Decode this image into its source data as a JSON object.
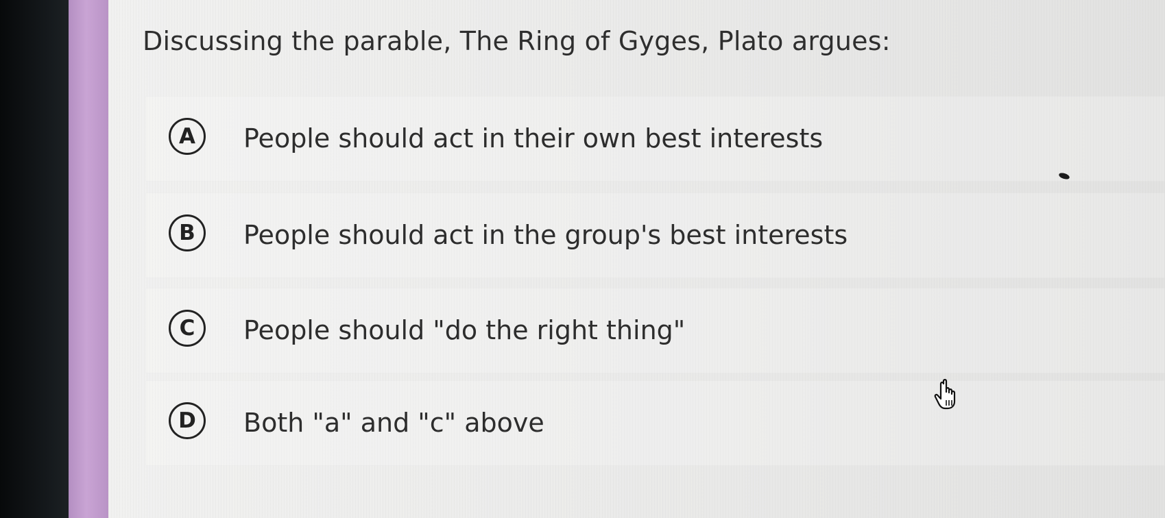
{
  "question": {
    "text": "Discussing the parable, The Ring of Gyges, Plato argues:"
  },
  "options": [
    {
      "letter": "A",
      "text": "People should act in their own best interests"
    },
    {
      "letter": "B",
      "text": "People should act in the group's best interests"
    },
    {
      "letter": "C",
      "text": "People should \"do the right thing\""
    },
    {
      "letter": "D",
      "text": "Both \"a\" and \"c\" above"
    }
  ],
  "cursor": {
    "icon": "hand-pointer-icon"
  },
  "colors": {
    "accent_bar": "#c9a4d4",
    "panel_bg": "#ececeb",
    "text": "#2e2e2e"
  }
}
